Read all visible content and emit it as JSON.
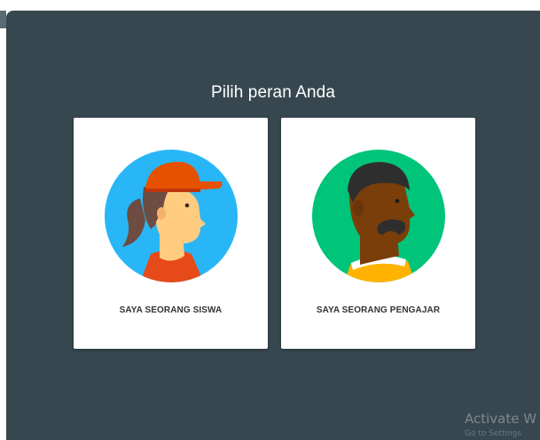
{
  "dialog": {
    "title": "Pilih peran Anda"
  },
  "roles": [
    {
      "label": "SAYA SEORANG SISWA",
      "icon": "student-avatar-icon"
    },
    {
      "label": "SAYA SEORANG PENGAJAR",
      "icon": "teacher-avatar-icon"
    }
  ],
  "watermark": {
    "line1": "Activate W",
    "line2": "Go to Settings"
  },
  "colors": {
    "dialog_bg": "#37474f",
    "student_circle": "#29b6f6",
    "teacher_circle": "#00c47a",
    "cap": "#e65100"
  }
}
